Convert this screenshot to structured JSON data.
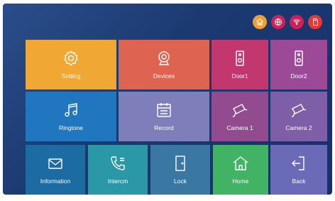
{
  "status_icons": [
    {
      "name": "home-status-icon",
      "color": "#f0a030"
    },
    {
      "name": "globe-icon",
      "color": "#d0205a"
    },
    {
      "name": "wifi-icon",
      "color": "#d0205a"
    },
    {
      "name": "sd-card-icon",
      "color": "#e03a3a"
    }
  ],
  "tiles": {
    "setting": {
      "label": "Setting",
      "color": "#f0a733"
    },
    "devices": {
      "label": "Devices",
      "color": "#de6451"
    },
    "door1": {
      "label": "Door1",
      "color": "#c2386e"
    },
    "door2": {
      "label": "Door2",
      "color": "#9c4a97"
    },
    "ringtone": {
      "label": "Ringtone",
      "color": "#2077c0"
    },
    "record": {
      "label": "Record",
      "color": "#7e7fba"
    },
    "camera1": {
      "label": "Camera 1",
      "color": "#934b8f"
    },
    "camera2": {
      "label": "Camera 2",
      "color": "#7e5ea7"
    },
    "information": {
      "label": "Information",
      "color": "#1c6ba2"
    },
    "intercom": {
      "label": "Intercm",
      "color": "#2a98a6"
    },
    "lock": {
      "label": "Lock",
      "color": "#3a78a3"
    },
    "home": {
      "label": "Home",
      "color": "#42b264"
    },
    "back": {
      "label": "Back",
      "color": "#6a6ab8"
    }
  }
}
